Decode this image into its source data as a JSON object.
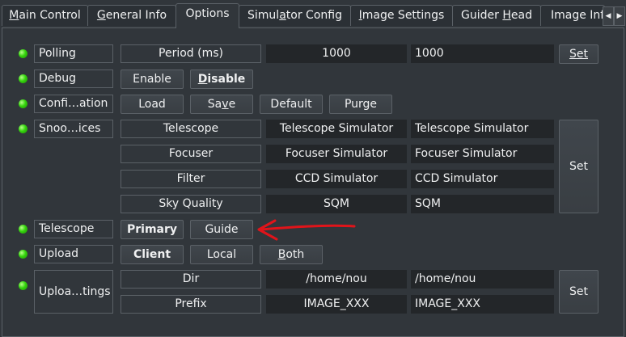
{
  "tabs": [
    {
      "label": "Main Control",
      "mnemonic": "M",
      "rest": "ain Control",
      "active": false
    },
    {
      "label": "General Info",
      "mnemonic": "G",
      "rest": "eneral Info",
      "active": false
    },
    {
      "label": "Options",
      "active": true
    },
    {
      "pre": "Simul",
      "mnemonic": "a",
      "rest": "tor Config",
      "label": "Simulator Config",
      "active": false
    },
    {
      "pre": "",
      "mnemonic": "I",
      "rest": "mage Settings",
      "label": "Image Settings",
      "active": false
    },
    {
      "pre": "Guider ",
      "mnemonic": "H",
      "rest": "ead",
      "label": "Guider Head",
      "active": false
    },
    {
      "label": "Image Inf",
      "active": false
    }
  ],
  "properties": {
    "polling": {
      "label": "Polling",
      "status": "ok",
      "element": "Period (ms)",
      "value": "1000",
      "input": "1000",
      "set_label": "Set"
    },
    "debug": {
      "label": "Debug",
      "status": "ok",
      "enable": "Enable",
      "disable": "Disable",
      "selected": "Disable"
    },
    "config": {
      "label": "Confi…ation",
      "status": "ok",
      "load": "Load",
      "save": "Save",
      "default": "Default",
      "purge": "Purge"
    },
    "snoop": {
      "label": "Snoo…ices",
      "status": "ok",
      "set_label": "Set",
      "rows": [
        {
          "element": "Telescope",
          "value": "Telescope Simulator",
          "input": "Telescope Simulator"
        },
        {
          "element": "Focuser",
          "value": "Focuser Simulator",
          "input": "Focuser Simulator"
        },
        {
          "element": "Filter",
          "value": "CCD Simulator",
          "input": "CCD Simulator"
        },
        {
          "element": "Sky Quality",
          "value": "SQM",
          "input": "SQM"
        }
      ]
    },
    "telescope": {
      "label": "Telescope",
      "status": "ok",
      "primary": "Primary",
      "guide": "Guide",
      "selected": "Primary"
    },
    "upload": {
      "label": "Upload",
      "status": "ok",
      "client": "Client",
      "local": "Local",
      "both": "Both",
      "selected": "Client"
    },
    "upload_settings": {
      "label": "Uploa…tings",
      "status": "ok",
      "set_label": "Set",
      "rows": [
        {
          "element": "Dir",
          "value": "/home/nou",
          "input": "/home/nou"
        },
        {
          "element": "Prefix",
          "value": "IMAGE_XXX",
          "input": "IMAGE_XXX"
        }
      ]
    }
  },
  "colors": {
    "background": "#31363b",
    "field": "#232629",
    "border": "#5b6167",
    "led_ok": "#35d40d",
    "annotation_arrow": "#e0141a"
  },
  "icons": {
    "status_light": "green-led-icon",
    "tab_scroll_left": "triangle-left-icon",
    "tab_scroll_right": "triangle-right-icon",
    "annotation": "red-arrow-icon"
  }
}
